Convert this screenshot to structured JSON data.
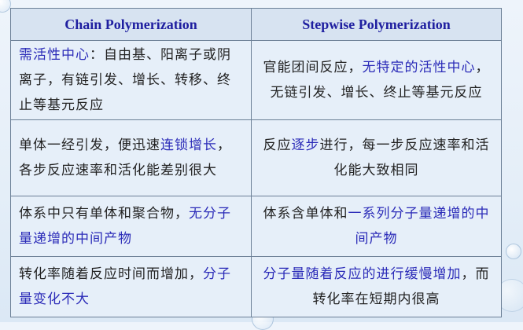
{
  "header": {
    "chain": "Chain Polymerization",
    "stepwise": "Stepwise Polymerization"
  },
  "rows": [
    {
      "chain": [
        {
          "t": "需活性中心",
          "hl": true
        },
        {
          "t": "：自由基、阳离子或阴离子，有链引发、增长、转移、终止等基元反应",
          "hl": false
        }
      ],
      "stepwise": [
        {
          "t": "官能团间反应，",
          "hl": false
        },
        {
          "t": "无特定的活性中心",
          "hl": true
        },
        {
          "t": "，无链引发、增长、终止等基元反应",
          "hl": false
        }
      ]
    },
    {
      "chain": [
        {
          "t": "单体一经引发，便迅速",
          "hl": false
        },
        {
          "t": "连锁增长",
          "hl": true
        },
        {
          "t": "，各步反应速率和活化能差别很大",
          "hl": false
        }
      ],
      "stepwise": [
        {
          "t": "反应",
          "hl": false
        },
        {
          "t": "逐步",
          "hl": true
        },
        {
          "t": "进行，每一步反应速率和活化能大致相同",
          "hl": false
        }
      ]
    },
    {
      "chain": [
        {
          "t": "体系中只有单体和聚合物，",
          "hl": false
        },
        {
          "t": "无分子量递增的中间产物",
          "hl": true
        }
      ],
      "stepwise": [
        {
          "t": "体系含单体和",
          "hl": false
        },
        {
          "t": "一系列分子量递增的中间产物",
          "hl": true
        }
      ]
    },
    {
      "chain": [
        {
          "t": "转化率随着反应时间而增加，",
          "hl": false
        },
        {
          "t": "分子量变化不大",
          "hl": true
        }
      ],
      "stepwise": [
        {
          "t": "分子量随着反应的进行缓慢增加",
          "hl": true
        },
        {
          "t": "，而转化率在短期内很高",
          "hl": false
        }
      ]
    }
  ],
  "colors": {
    "highlight": "#2b2bb8",
    "text": "#222222",
    "header": "#1f1fa0"
  }
}
